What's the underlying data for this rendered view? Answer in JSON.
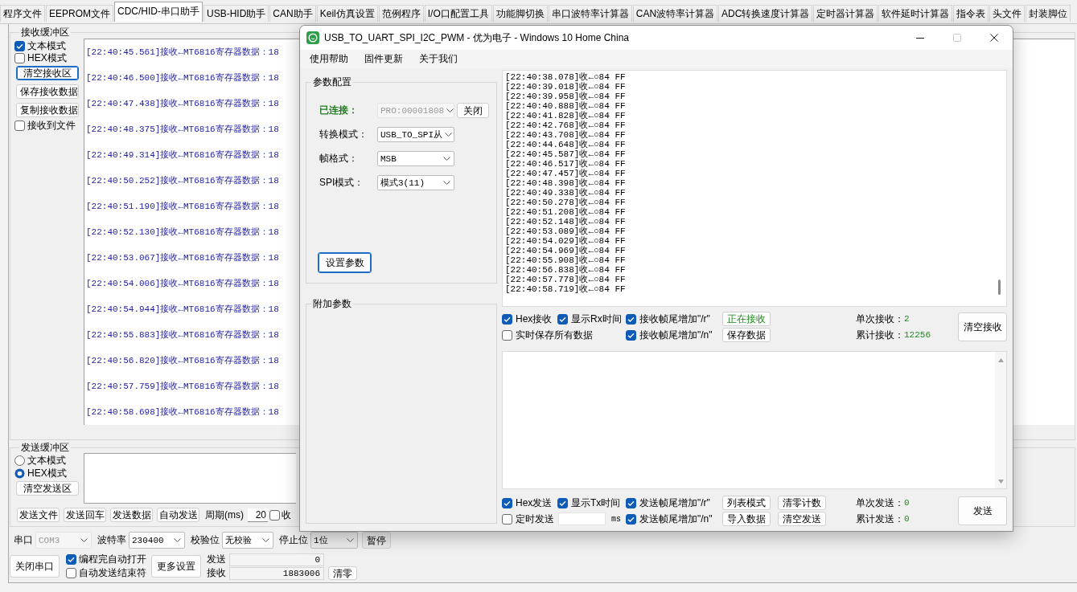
{
  "tabs": [
    {
      "label": "程序文件",
      "selected": false
    },
    {
      "label": "EEPROM文件",
      "selected": false
    },
    {
      "label": "CDC/HID-串口助手",
      "selected": true
    },
    {
      "label": "USB-HID助手",
      "selected": false
    },
    {
      "label": "CAN助手",
      "selected": false
    },
    {
      "label": "Keil仿真设置",
      "selected": false
    },
    {
      "label": "范例程序",
      "selected": false
    },
    {
      "label": "I/O口配置工具",
      "selected": false
    },
    {
      "label": "功能脚切换",
      "selected": false
    },
    {
      "label": "串口波特率计算器",
      "selected": false
    },
    {
      "label": "CAN波特率计算器",
      "selected": false
    },
    {
      "label": "ADC转换速度计算器",
      "selected": false
    },
    {
      "label": "定时器计算器",
      "selected": false
    },
    {
      "label": "软件延时计算器",
      "selected": false
    },
    {
      "label": "指令表",
      "selected": false
    },
    {
      "label": "头文件",
      "selected": false
    },
    {
      "label": "封装脚位",
      "selected": false
    }
  ],
  "receive_buffer": {
    "title": "接收缓冲区",
    "controls": [
      {
        "kind": "checkbox",
        "label": "文本模式",
        "checked": true
      },
      {
        "kind": "checkbox",
        "label": "HEX模式",
        "checked": false
      },
      {
        "kind": "button",
        "label": "清空接收区",
        "focused": true
      },
      {
        "kind": "button",
        "label": "保存接收数据",
        "focused": false
      },
      {
        "kind": "button",
        "label": "复制接收数据",
        "focused": false
      },
      {
        "kind": "checkbox",
        "label": "接收到文件",
        "checked": false
      }
    ],
    "lines": [
      "[22:40:45.561]接收←MT6816寄存器数据：18",
      "[22:40:46.500]接收←MT6816寄存器数据：18",
      "[22:40:47.438]接收←MT6816寄存器数据：18",
      "[22:40:48.375]接收←MT6816寄存器数据：18",
      "[22:40:49.314]接收←MT6816寄存器数据：18",
      "[22:40:50.252]接收←MT6816寄存器数据：18",
      "[22:40:51.190]接收←MT6816寄存器数据：18",
      "[22:40:52.130]接收←MT6816寄存器数据：18",
      "[22:40:53.067]接收←MT6816寄存器数据：18",
      "[22:40:54.006]接收←MT6816寄存器数据：18",
      "[22:40:54.944]接收←MT6816寄存器数据：18",
      "[22:40:55.883]接收←MT6816寄存器数据：18",
      "[22:40:56.820]接收←MT6816寄存器数据：18",
      "[22:40:57.759]接收←MT6816寄存器数据：18",
      "[22:40:58.698]接收←MT6816寄存器数据：18"
    ]
  },
  "send_buffer": {
    "title": "发送缓冲区",
    "modes": [
      {
        "label": "文本模式",
        "selected": false
      },
      {
        "label": "HEX模式",
        "selected": true
      }
    ],
    "clear_button": "清空发送区",
    "buttons": [
      "发送文件",
      "发送回车",
      "发送数据",
      "自动发送"
    ],
    "period_label": "周期(ms)",
    "period_value": "20",
    "checkbox": {
      "label": "收",
      "checked": false
    }
  },
  "port": {
    "fields": [
      {
        "label": "串口",
        "value": "COM3",
        "disabled": true
      },
      {
        "label": "波特率",
        "value": "230400",
        "disabled": false
      },
      {
        "label": "校验位",
        "value": "无校验",
        "disabled": false
      },
      {
        "label": "停止位",
        "value": "1位",
        "disabled": false
      }
    ],
    "pause_button": "暂停",
    "close_button": "关闭串口",
    "options": [
      {
        "label": "编程完自动打开",
        "checked": true
      },
      {
        "label": "自动发送结束符",
        "checked": false
      }
    ],
    "more_button": "更多设置",
    "counters": [
      {
        "label": "发送",
        "value": "0"
      },
      {
        "label": "接收",
        "value": "1883006"
      }
    ],
    "reset_button": "清零"
  },
  "dialog": {
    "title": "USB_TO_UART_SPI_I2C_PWM - 优为电子 - Windows 10 Home China",
    "window_buttons": [
      {
        "kind": "minimize",
        "disabled": false
      },
      {
        "kind": "maximize",
        "disabled": true
      },
      {
        "kind": "close",
        "disabled": false
      }
    ],
    "menu": [
      "使用帮助",
      "固件更新",
      "关于我们"
    ],
    "config": {
      "title": "参数配置",
      "status_label": "已连接：",
      "device": {
        "value": "PRO:00001808",
        "disabled": true
      },
      "close_button": "关闭",
      "fields": [
        {
          "label": "转换模式：",
          "value": "USB_TO_SPI从"
        },
        {
          "label": "帧格式：",
          "value": "MSB"
        },
        {
          "label": "SPI模式：",
          "value": "模式3(11)"
        }
      ],
      "apply_button": "设置参数"
    },
    "extra": {
      "title": "附加参数"
    },
    "receive": {
      "lines": [
        "[22:40:38.078]收←○84 FF",
        "[22:40:39.018]收←○84 FF",
        "[22:40:39.958]收←○84 FF",
        "[22:40:40.888]收←○84 FF",
        "[22:40:41.828]收←○84 FF",
        "[22:40:42.768]收←○84 FF",
        "[22:40:43.708]收←○84 FF",
        "[22:40:44.648]收←○84 FF",
        "[22:40:45.587]收←○84 FF",
        "[22:40:46.517]收←○84 FF",
        "[22:40:47.457]收←○84 FF",
        "[22:40:48.398]收←○84 FF",
        "[22:40:49.338]收←○84 FF",
        "[22:40:50.278]收←○84 FF",
        "[22:40:51.208]收←○84 FF",
        "[22:40:52.148]收←○84 FF",
        "[22:40:53.089]收←○84 FF",
        "[22:40:54.029]收←○84 FF",
        "[22:40:54.969]收←○84 FF",
        "[22:40:55.908]收←○84 FF",
        "[22:40:56.838]收←○84 FF",
        "[22:40:57.778]收←○84 FF",
        "[22:40:58.719]收←○84 FF"
      ],
      "options": [
        [
          {
            "label": "Hex接收",
            "checked": true
          },
          {
            "label": "显示Rx时间",
            "checked": true
          },
          {
            "label": "接收帧尾增加\"/r\"",
            "checked": true
          }
        ],
        [
          {
            "label": "实时保存所有数据",
            "checked": false
          },
          {
            "label": "接收帧尾增加\"/n\"",
            "checked": true
          }
        ]
      ],
      "buttons": [
        {
          "label": "正在接收",
          "active": true
        },
        {
          "label": "保存数据",
          "active": false
        }
      ],
      "stats": [
        {
          "label": "单次接收：",
          "value": "2"
        },
        {
          "label": "累计接收：",
          "value": "12256"
        }
      ],
      "clear_button": "清空接收"
    },
    "send": {
      "options": [
        [
          {
            "kind": "checkbox",
            "label": "Hex发送",
            "checked": true
          },
          {
            "kind": "checkbox",
            "label": "显示Tx时间",
            "checked": true
          },
          {
            "kind": "checkbox",
            "label": "发送帧尾增加\"/r\"",
            "checked": true
          }
        ],
        [
          {
            "kind": "timed",
            "label": "定时发送",
            "checked": false,
            "unit": "ms"
          },
          {
            "kind": "checkbox",
            "label": "发送帧尾增加\"/n\"",
            "checked": true
          }
        ]
      ],
      "buttons": [
        "列表模式",
        "清零计数",
        "导入数据",
        "清空发送"
      ],
      "stats": [
        {
          "label": "单次发送：",
          "value": "0"
        },
        {
          "label": "累计发送：",
          "value": "0"
        }
      ],
      "send_button": "发送"
    }
  }
}
